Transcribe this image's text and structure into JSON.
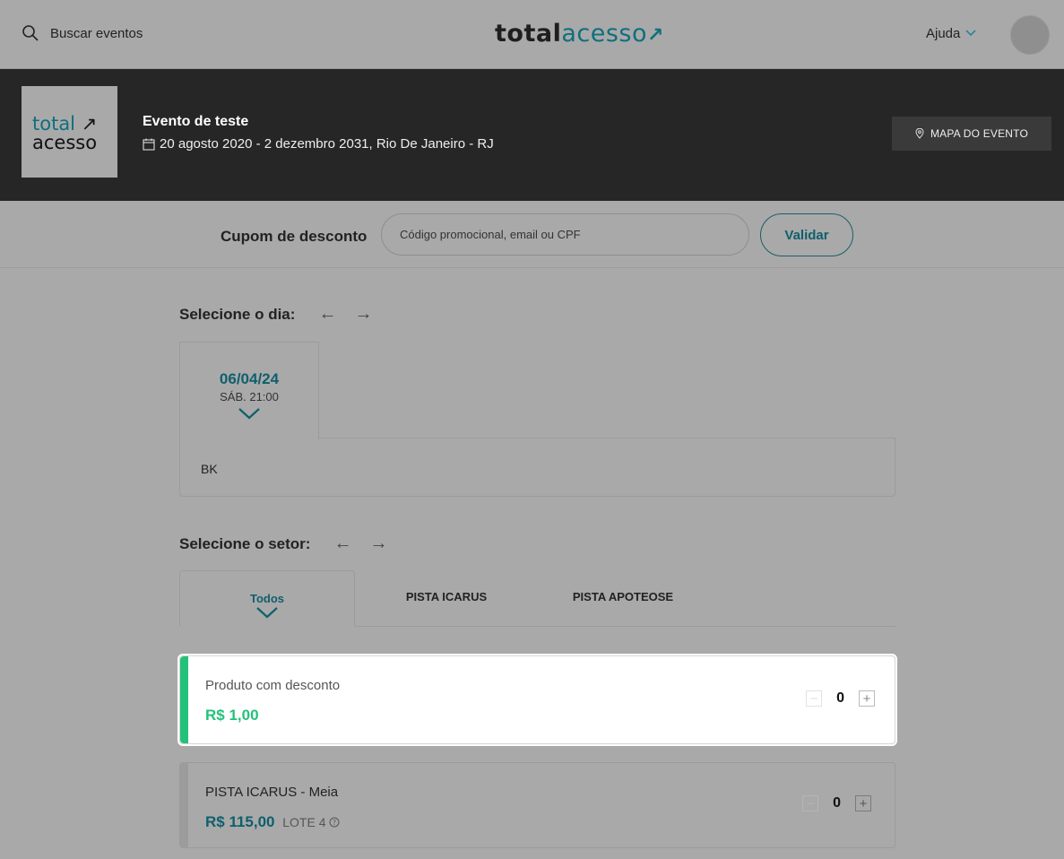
{
  "header": {
    "search_label": "Buscar eventos",
    "brand_dark": "total",
    "brand_accent": "acesso",
    "help_label": "Ajuda"
  },
  "event": {
    "logo_line1": "total",
    "logo_line2": "acesso",
    "title": "Evento de teste",
    "date_location": "20 agosto 2020 - 2 dezembro 2031, Rio De Janeiro - RJ",
    "map_button": "MAPA DO EVENTO"
  },
  "coupon": {
    "label": "Cupom de desconto",
    "placeholder": "Código promocional, email ou CPF",
    "validate_button": "Validar"
  },
  "day_section": {
    "title": "Selecione o dia:",
    "selected_date": "06/04/24",
    "selected_time": "SÁB. 21:00",
    "content": "BK"
  },
  "sector_section": {
    "title": "Selecione o setor:",
    "tabs": [
      "Todos",
      "PISTA ICARUS",
      "PISTA APOTEOSE"
    ]
  },
  "products": [
    {
      "name": "Produto com desconto",
      "price": "R$ 1,00",
      "lote": "",
      "qty": "0"
    },
    {
      "name": "PISTA ICARUS - Meia",
      "price": "R$ 115,00",
      "lote": "LOTE 4",
      "qty": "0"
    }
  ],
  "colors": {
    "accent": "#0f5f6d",
    "green": "#24c17a",
    "banner": "#262626"
  }
}
